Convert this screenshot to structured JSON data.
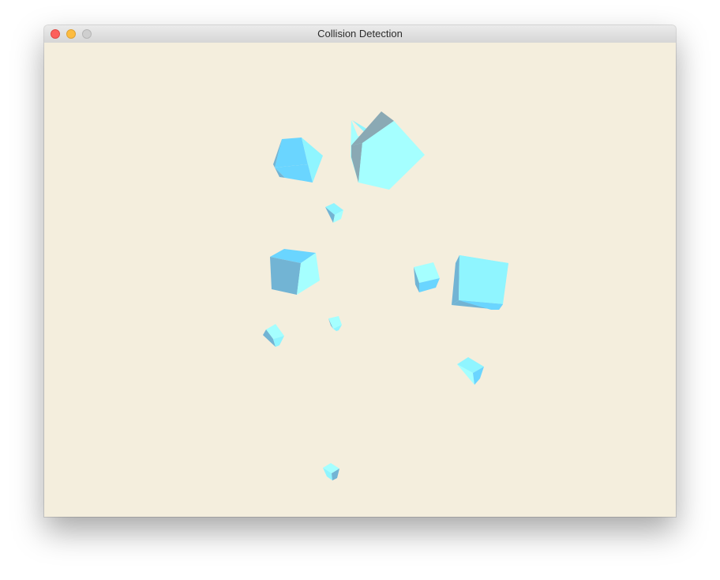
{
  "window": {
    "title": "Collision Detection",
    "background_color": "#f4eedd",
    "controls": [
      {
        "name": "close",
        "color": "#fc605c"
      },
      {
        "name": "minimize",
        "color": "#fdbc40"
      },
      {
        "name": "zoom",
        "color": "#cfcfcf"
      }
    ]
  },
  "scene": {
    "object_kind": "cube",
    "object_count": 11,
    "face_colors": [
      "#a5ffff",
      "#8ff5ff",
      "#6ad5ff",
      "#72b4d4",
      "#8aa9b4"
    ]
  }
}
